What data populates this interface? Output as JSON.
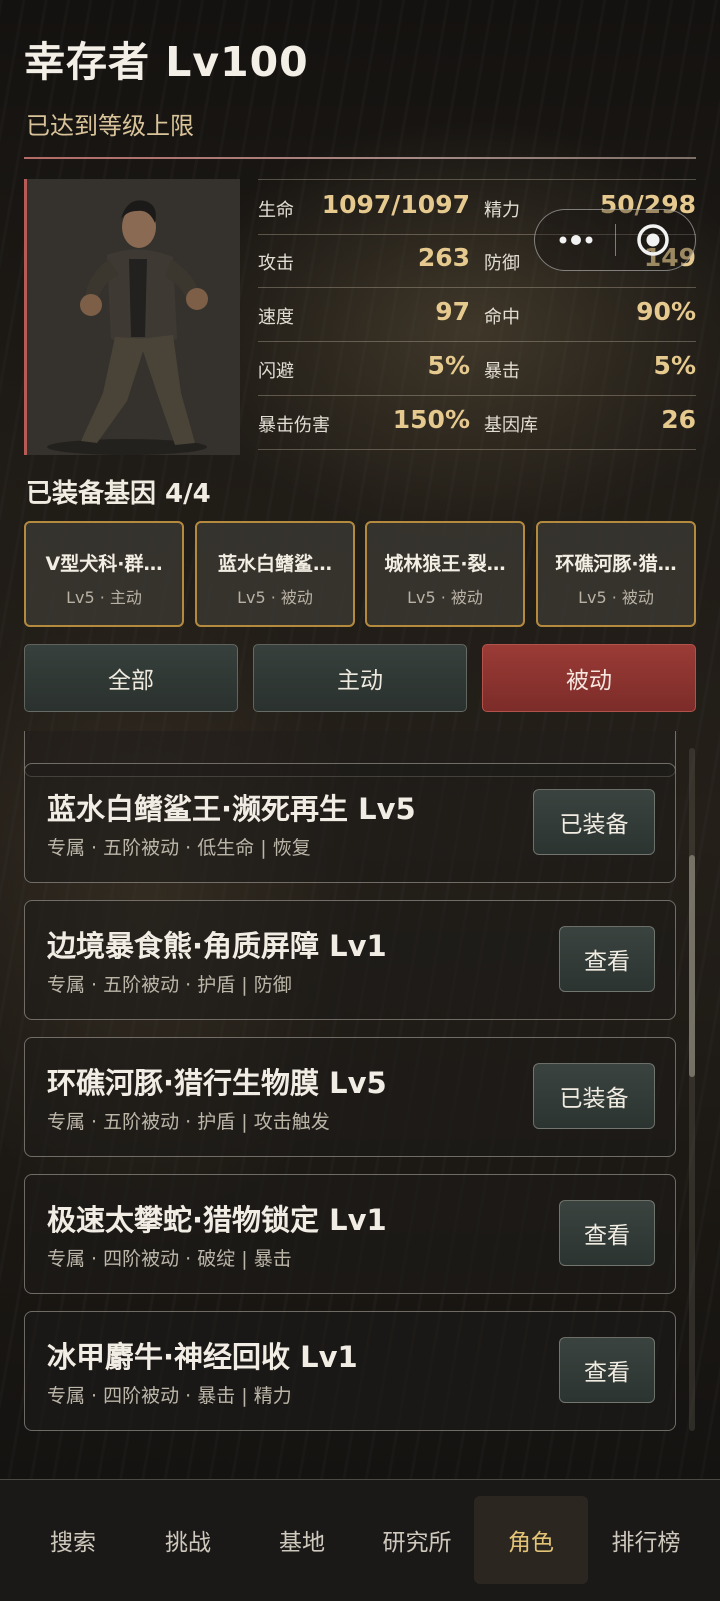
{
  "header": {
    "title": "幸存者 Lv100",
    "subtitle": "已达到等级上限"
  },
  "stats": [
    {
      "label": "生命",
      "value": "1097/1097"
    },
    {
      "label": "精力",
      "value": "50/298"
    },
    {
      "label": "攻击",
      "value": "263"
    },
    {
      "label": "防御",
      "value": "149"
    },
    {
      "label": "速度",
      "value": "97"
    },
    {
      "label": "命中",
      "value": "90%"
    },
    {
      "label": "闪避",
      "value": "5%"
    },
    {
      "label": "暴击",
      "value": "5%"
    },
    {
      "label": "暴击伤害",
      "value": "150%"
    },
    {
      "label": "基因库",
      "value": "26"
    }
  ],
  "genes": {
    "heading": "已装备基因 4/4",
    "slots": [
      {
        "name": "V型犬科·群…",
        "meta": "Lv5 · 主动"
      },
      {
        "name": "蓝水白鳍鲨…",
        "meta": "Lv5 · 被动"
      },
      {
        "name": "城林狼王·裂…",
        "meta": "Lv5 · 被动"
      },
      {
        "name": "环礁河豚·猎…",
        "meta": "Lv5 · 被动"
      }
    ]
  },
  "filters": {
    "all": "全部",
    "active": "主动",
    "passive": "被动",
    "selected": "被动"
  },
  "list": [
    {
      "title": "蓝水白鳍鲨王·濒死再生 Lv5",
      "desc": "专属 · 五阶被动 · 低生命 | 恢复",
      "button": "已装备"
    },
    {
      "title": "边境暴食熊·角质屏障 Lv1",
      "desc": "专属 · 五阶被动 · 护盾 | 防御",
      "button": "查看"
    },
    {
      "title": "环礁河豚·猎行生物膜 Lv5",
      "desc": "专属 · 五阶被动 · 护盾 | 攻击触发",
      "button": "已装备"
    },
    {
      "title": "极速太攀蛇·猎物锁定 Lv1",
      "desc": "专属 · 四阶被动 · 破绽 | 暴击",
      "button": "查看"
    },
    {
      "title": "冰甲麝牛·神经回收 Lv1",
      "desc": "专属 · 四阶被动 · 暴击 | 精力",
      "button": "查看"
    }
  ],
  "tabs": [
    {
      "label": "搜索"
    },
    {
      "label": "挑战"
    },
    {
      "label": "基地"
    },
    {
      "label": "研究所"
    },
    {
      "label": "角色"
    },
    {
      "label": "排行榜"
    }
  ],
  "active_tab": "角色",
  "colors": {
    "accent_gold": "#e5c98e",
    "active_filter": "#9b3b36",
    "slot_border": "#b48a3f",
    "active_tab_text": "#e3c477"
  },
  "icons": {
    "capsule_more": "more-dots-icon",
    "capsule_close": "close-mini-program-icon"
  }
}
